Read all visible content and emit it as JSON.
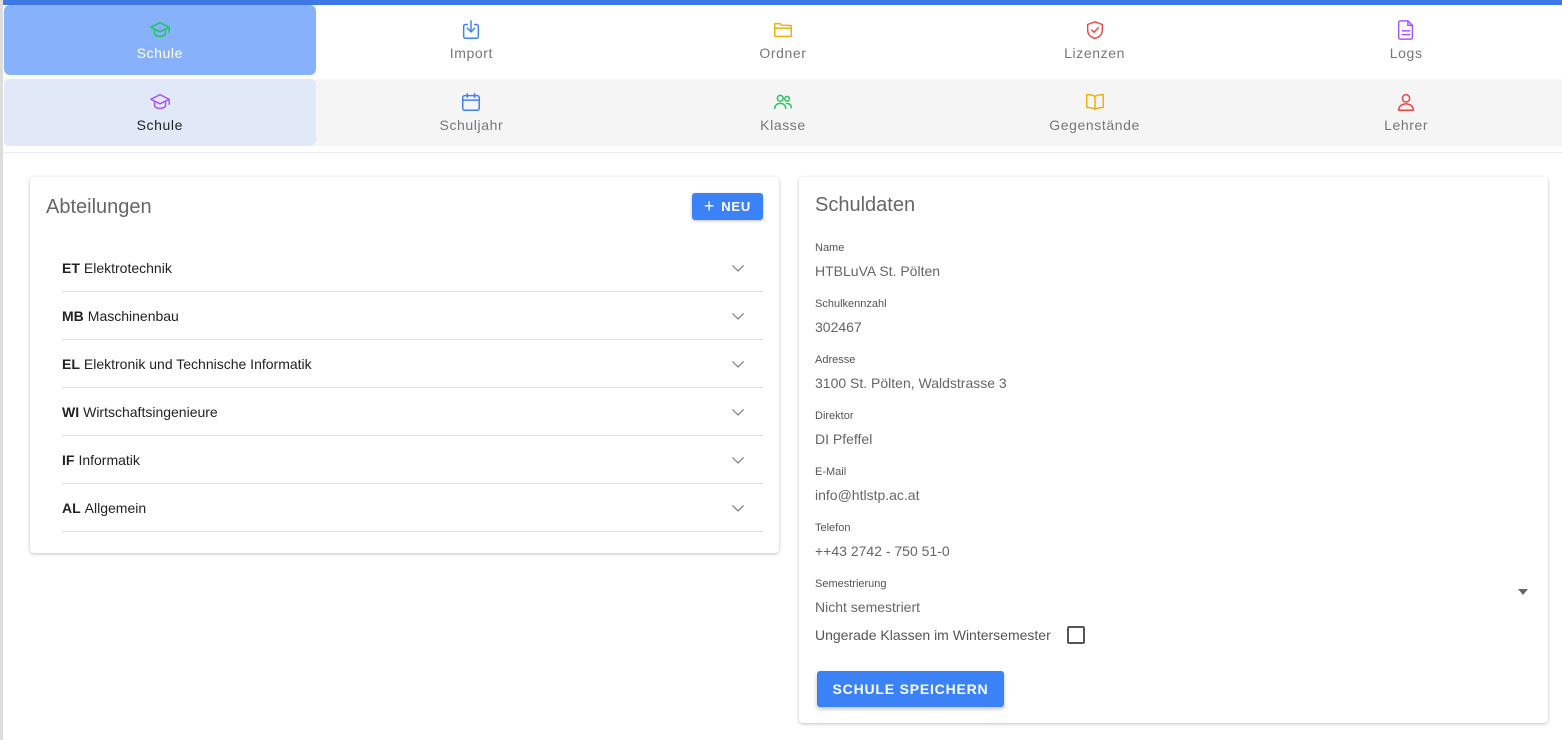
{
  "colors": {
    "accent": "#3b82f6",
    "active_main_tab": "#87b1fb",
    "active_sub_tab": "#e1e8f7",
    "icon_school_main": "#22c55e",
    "icon_import": "#3b82f6",
    "icon_folder": "#eab308",
    "icon_licenses": "#ef4444",
    "icon_logs": "#a855f7"
  },
  "main_nav": {
    "tabs": [
      {
        "label": "Schule",
        "icon": "graduation-cap-icon",
        "active": true
      },
      {
        "label": "Import",
        "icon": "download-icon",
        "active": false
      },
      {
        "label": "Ordner",
        "icon": "folder-icon",
        "active": false
      },
      {
        "label": "Lizenzen",
        "icon": "shield-check-icon",
        "active": false
      },
      {
        "label": "Logs",
        "icon": "document-icon",
        "active": false
      }
    ]
  },
  "sub_nav": {
    "tabs": [
      {
        "label": "Schule",
        "icon": "graduation-cap-icon",
        "active": true
      },
      {
        "label": "Schuljahr",
        "icon": "calendar-icon",
        "active": false
      },
      {
        "label": "Klasse",
        "icon": "users-icon",
        "active": false
      },
      {
        "label": "Gegenstände",
        "icon": "book-icon",
        "active": false
      },
      {
        "label": "Lehrer",
        "icon": "user-icon",
        "active": false
      }
    ]
  },
  "departments": {
    "title": "Abteilungen",
    "new_button": "NEU",
    "items": [
      {
        "code": "ET",
        "name": "Elektrotechnik"
      },
      {
        "code": "MB",
        "name": "Maschinenbau"
      },
      {
        "code": "EL",
        "name": "Elektronik und Technische Informatik"
      },
      {
        "code": "WI",
        "name": "Wirtschaftsingenieure"
      },
      {
        "code": "IF",
        "name": "Informatik"
      },
      {
        "code": "AL",
        "name": "Allgemein"
      }
    ]
  },
  "school": {
    "title": "Schuldaten",
    "fields": {
      "name": {
        "label": "Name",
        "value": "HTBLuVA St. Pölten"
      },
      "code": {
        "label": "Schulkennzahl",
        "value": "302467"
      },
      "address": {
        "label": "Adresse",
        "value": "3100 St. Pölten, Waldstrasse 3"
      },
      "director": {
        "label": "Direktor",
        "value": "DI Pfeffel"
      },
      "email": {
        "label": "E-Mail",
        "value": "info@htlstp.ac.at"
      },
      "phone": {
        "label": "Telefon",
        "value": "++43 2742 - 750 51-0"
      },
      "semester": {
        "label": "Semestrierung",
        "value": "Nicht semestriert"
      }
    },
    "odd_classes_label": "Ungerade Klassen im Wintersemester",
    "odd_classes_checked": false,
    "save_button": "SCHULE SPEICHERN"
  }
}
